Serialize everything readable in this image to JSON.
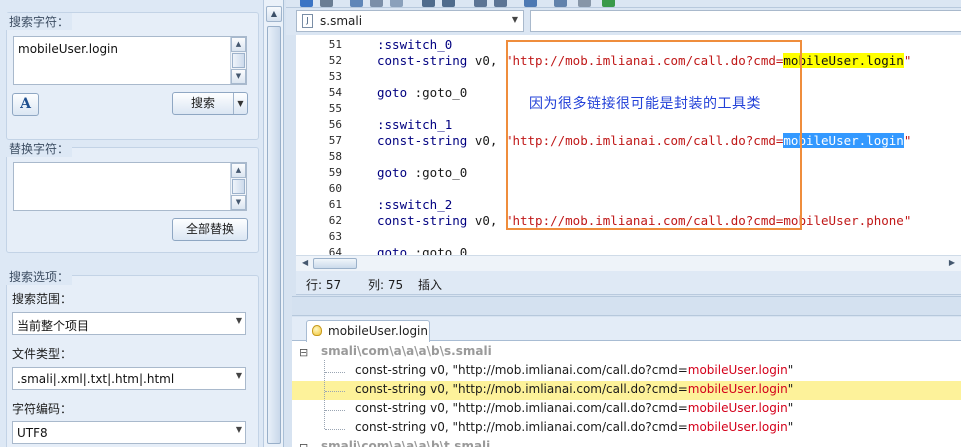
{
  "search_panel": {
    "find_title": "搜索字符：",
    "find_value": "mobileUser.login",
    "case_icon": "font-case-icon",
    "search_button": "搜索",
    "replace_title": "替换字符：",
    "replace_value": "",
    "replace_all_button": "全部替换",
    "options_title": "搜索选项：",
    "scope_label": "搜索范围：",
    "scope_value": "当前整个项目",
    "filetype_label": "文件类型：",
    "filetype_value": ".smali|.xml|.txt|.htm|.html",
    "encoding_label": "字符编码：",
    "encoding_value": "UTF8"
  },
  "editor": {
    "file_tab": "s.smali",
    "lines": [
      {
        "num": "51",
        "indent": "    ",
        "kw": ":sswitch_0",
        "pre": "",
        "url": "",
        "match": "",
        "post": "",
        "hl": ""
      },
      {
        "num": "52",
        "indent": "    ",
        "kw": "const-string",
        "pre": " v0, ",
        "url": "\"http://mob.imlianai.com/call.do?cmd=",
        "match": "mobileUser.login",
        "post": "\"",
        "hl": "yellow"
      },
      {
        "num": "53",
        "indent": "",
        "kw": "",
        "pre": "",
        "url": "",
        "match": "",
        "post": "",
        "hl": ""
      },
      {
        "num": "54",
        "indent": "    ",
        "kw": "goto",
        "pre": " :goto_0",
        "url": "",
        "match": "",
        "post": "",
        "hl": ""
      },
      {
        "num": "55",
        "indent": "",
        "kw": "",
        "pre": "",
        "url": "",
        "match": "",
        "post": "",
        "hl": ""
      },
      {
        "num": "56",
        "indent": "    ",
        "kw": ":sswitch_1",
        "pre": "",
        "url": "",
        "match": "",
        "post": "",
        "hl": ""
      },
      {
        "num": "57",
        "indent": "    ",
        "kw": "const-string",
        "pre": " v0, ",
        "url": "\"http://mob.imlianai.com/call.do?cmd=",
        "match": "mobileUser.login",
        "post": "\"",
        "hl": "blue"
      },
      {
        "num": "58",
        "indent": "",
        "kw": "",
        "pre": "",
        "url": "",
        "match": "",
        "post": "",
        "hl": ""
      },
      {
        "num": "59",
        "indent": "    ",
        "kw": "goto",
        "pre": " :goto_0",
        "url": "",
        "match": "",
        "post": "",
        "hl": ""
      },
      {
        "num": "60",
        "indent": "",
        "kw": "",
        "pre": "",
        "url": "",
        "match": "",
        "post": "",
        "hl": ""
      },
      {
        "num": "61",
        "indent": "    ",
        "kw": ":sswitch_2",
        "pre": "",
        "url": "",
        "match": "",
        "post": "",
        "hl": ""
      },
      {
        "num": "62",
        "indent": "    ",
        "kw": "const-string",
        "pre": " v0, ",
        "url": "\"http://mob.imlianai.com/call.do?cmd=",
        "match": "mobileUser.phone\"",
        "post": "",
        "hl": ""
      },
      {
        "num": "63",
        "indent": "",
        "kw": "",
        "pre": "",
        "url": "",
        "match": "",
        "post": "",
        "hl": ""
      },
      {
        "num": "64",
        "indent": "    ",
        "kw": "goto",
        "pre": " :goto_0",
        "url": "",
        "match": "",
        "post": "",
        "hl": ""
      }
    ],
    "annotation": "因为很多链接很可能是封装的工具类"
  },
  "status": {
    "row": "行: 57",
    "col": "列: 75",
    "mode": "插入"
  },
  "results": {
    "tab_label": "mobileUser.login",
    "groups": [
      {
        "path": "smali\\com\\a\\a\\a\\b\\s.smali",
        "rows": [
          {
            "pre": "const-string v0, \"http://mob.imlianai.com/call.do?cmd=",
            "match": "mobileUser.login",
            "post": "\"",
            "selected": false
          },
          {
            "pre": "const-string v0, \"http://mob.imlianai.com/call.do?cmd=",
            "match": "mobileUser.login",
            "post": "\"",
            "selected": true
          },
          {
            "pre": "const-string v0, \"http://mob.imlianai.com/call.do?cmd=",
            "match": "mobileUser.login",
            "post": "\"",
            "selected": false
          },
          {
            "pre": "const-string v0, \"http://mob.imlianai.com/call.do?cmd=",
            "match": "mobileUser.login",
            "post": "\"",
            "selected": false
          }
        ]
      },
      {
        "path": "smali\\com\\a\\a\\a\\b\\t.smali",
        "rows": []
      }
    ]
  }
}
